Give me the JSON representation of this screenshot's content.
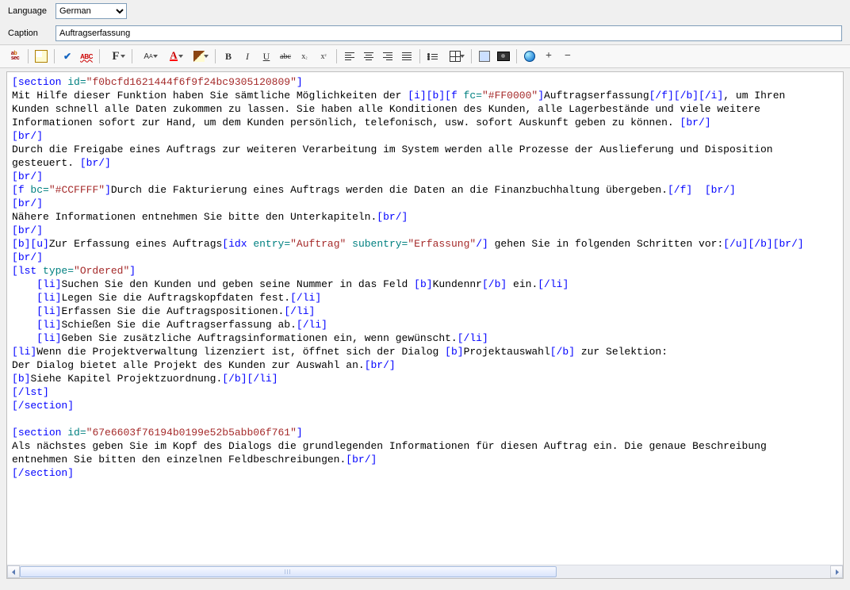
{
  "form": {
    "language_label": "Language",
    "language_value": "German",
    "caption_label": "Caption",
    "caption_value": "Auftragserfassung"
  },
  "toolbar": {
    "abc_sec_text": "ABC"
  },
  "code": {
    "s1_open_a": "[",
    "s1_open_b": "section",
    "s1_attr": " id=",
    "s1_val": "\"f0bcfd1621444f6f9f24bc9305120809\"",
    "s1_open_c": "]",
    "l2_a": "Mit Hilfe dieser Funktion haben Sie sämtliche Möglichkeiten der ",
    "l2_b": "[",
    "l2_c": "i",
    "l2_d": "][",
    "l2_e": "b",
    "l2_f": "][",
    "l2_g": "f",
    "l2_h": " fc=",
    "l2_i": "\"#FF0000\"",
    "l2_j": "]",
    "l2_k": "Auftragserfassung",
    "l2_l": "[/",
    "l2_m": "f",
    "l2_n": "][/",
    "l2_o": "b",
    "l2_p": "][/",
    "l2_q": "i",
    "l2_r": "]",
    "l2_s": ", um Ihren",
    "l3": "Kunden schnell alle Daten zukommen zu lassen. Sie haben alle Konditionen des Kunden, alle Lagerbestände und viele weitere",
    "l4_a": "Informationen sofort zur Hand, um dem Kunden persönlich, telefonisch, usw. sofort Auskunft geben zu können. ",
    "l4_b": "[",
    "l4_c": "br/",
    "l4_d": "]",
    "br_o": "[",
    "br_t": "br/",
    "br_c": "]",
    "l6_a": "Durch die Freigabe eines Auftrags zur weiteren Verarbeitung im System werden alle Prozesse der Auslieferung und Disposition",
    "l7_a": "gesteuert. ",
    "l9_a": "[",
    "l9_b": "f",
    "l9_c": " bc=",
    "l9_d": "\"#CCFFFF\"",
    "l9_e": "]",
    "l9_f": "Durch die Fakturierung eines Auftrags werden die Daten an die Finanzbuchhaltung übergeben.",
    "l9_g": "[/",
    "l9_h": "f",
    "l9_i": "]  ",
    "l11_a": "Nähere Informationen entnehmen Sie bitte den Unterkapiteln.",
    "l13_a": "[",
    "l13_b": "b",
    "l13_c": "][",
    "l13_d": "u",
    "l13_e": "]",
    "l13_f": "Zur Erfassung eines Auftrags",
    "l13_g": "[",
    "l13_h": "idx",
    "l13_i": " entry=",
    "l13_j": "\"Auftrag\"",
    "l13_k": " subentry=",
    "l13_l": "\"Erfassung\"",
    "l13_m": "/]",
    "l13_n": " gehen Sie in folgenden Schritten vor:",
    "l13_o": "[/",
    "l13_p": "u",
    "l13_q": "][/",
    "l13_r": "b",
    "l13_s": "][",
    "l13_t": "br/",
    "l13_u": "]",
    "l15_a": "[",
    "l15_b": "lst",
    "l15_c": " type=",
    "l15_d": "\"Ordered\"",
    "l15_e": "]",
    "li_o": "[",
    "li_t": "li",
    "li_c": "]",
    "li_co": "[/",
    "li_ct": "li",
    "li_cc": "]",
    "l16_a": "Suchen Sie den Kunden und geben seine Nummer in das Feld ",
    "l16_b": "[",
    "l16_c": "b",
    "l16_d": "]",
    "l16_e": "Kundennr",
    "l16_f": "[/",
    "l16_g": "b",
    "l16_h": "]",
    "l16_i": " ein.",
    "l17_a": "Legen Sie die Auftragskopfdaten fest.",
    "l18_a": "Erfassen Sie die Auftragspositionen.",
    "l19_a": "Schießen Sie die Auftragserfassung ab.",
    "l20_a": "Geben Sie zusätzliche Auftragsinformationen ein, wenn gewünscht.",
    "l21_a": "Wenn die Projektverwaltung lizenziert ist, öffnet sich der Dialog ",
    "l21_b": "[",
    "l21_c": "b",
    "l21_d": "]",
    "l21_e": "Projektauswahl",
    "l21_f": "[/",
    "l21_g": "b",
    "l21_h": "]",
    "l21_i": " zur Selektion:",
    "l22_a": "Der Dialog bietet alle Projekt des Kunden zur Auswahl an.",
    "l23_a": "[",
    "l23_b": "b",
    "l23_c": "]",
    "l23_d": "Siehe Kapitel Projektzuordnung.",
    "l23_e": "[/",
    "l23_f": "b",
    "l23_g": "]",
    "lst_co": "[/",
    "lst_ct": "lst",
    "lst_cc": "]",
    "sec_co": "[/",
    "sec_ct": "section",
    "sec_cc": "]",
    "s2_open_a": "[",
    "s2_open_b": "section",
    "s2_attr": " id=",
    "s2_val": "\"67e6603f76194b0199e52b5abb06f761\"",
    "s2_open_c": "]",
    "l28_a": "Als nächstes geben Sie im Kopf des Dialogs die grundlegenden Informationen für diesen Auftrag ein. Die genaue Beschreibung",
    "l29_a": "entnehmen Sie bitten den einzelnen Feldbeschreibungen.",
    "indent1": "    "
  }
}
